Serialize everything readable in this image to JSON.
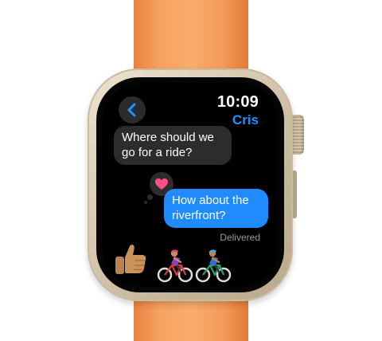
{
  "watch": {
    "time": "10:09",
    "contact_name": "Cris",
    "back_button_icon": "chevron-left-icon"
  },
  "messages": [
    {
      "direction": "incoming",
      "text": "Where should we go for a ride?"
    },
    {
      "direction": "outgoing",
      "text": "How about the riverfront?",
      "tapback": "heart-icon",
      "status": "Delivered"
    }
  ],
  "emojis": [
    "thumbs-up-icon",
    "cyclist-icon",
    "cyclist-icon"
  ],
  "colors": {
    "strap": "#f6a160",
    "case": "#d8c9b1",
    "screen_bg": "#000000",
    "incoming_bubble": "#2c2c2e",
    "outgoing_bubble": "#1f8bff",
    "accent": "#1e92ff",
    "tapback_heart": "#ff4f8b",
    "status_text": "#9a9a9f"
  }
}
